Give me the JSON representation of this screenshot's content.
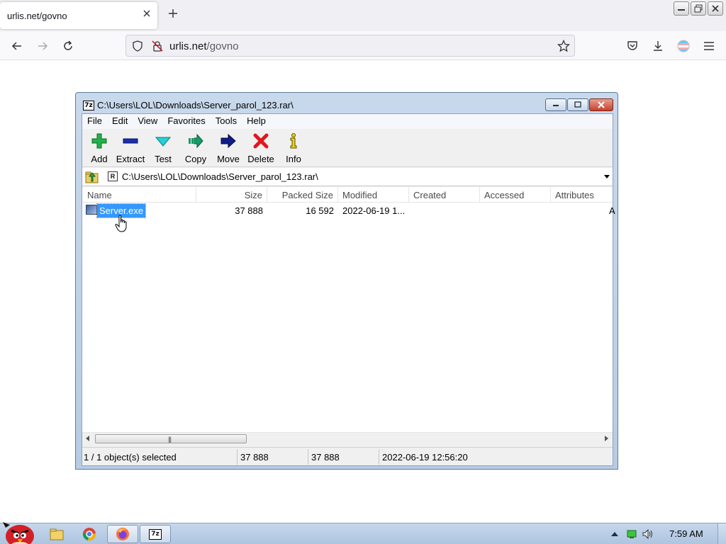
{
  "browser": {
    "tab_title": "urlis.net/govno",
    "url_host": "urlis.net",
    "url_path": "/govno"
  },
  "window": {
    "title": "C:\\Users\\LOL\\Downloads\\Server_parol_123.rar\\",
    "menu": [
      "File",
      "Edit",
      "View",
      "Favorites",
      "Tools",
      "Help"
    ],
    "toolbar": {
      "add": "Add",
      "extract": "Extract",
      "test": "Test",
      "copy": "Copy",
      "move": "Move",
      "delete": "Delete",
      "info": "Info"
    },
    "address": "C:\\Users\\LOL\\Downloads\\Server_parol_123.rar\\",
    "columns": [
      "Name",
      "Size",
      "Packed Size",
      "Modified",
      "Created",
      "Accessed",
      "Attributes"
    ],
    "rows": [
      {
        "name": "Server.exe",
        "size": "37 888",
        "packed": "16 592",
        "modified": "2022-06-19 1...",
        "created": "",
        "accessed": "",
        "attributes": "A"
      }
    ],
    "status": {
      "selection": "1 / 1 object(s) selected",
      "size": "37 888",
      "packed": "37 888",
      "modified": "2022-06-19 12:56:20"
    }
  },
  "taskbar": {
    "clock": "7:59 AM"
  },
  "icons": {
    "tab_close": "close-icon",
    "new_tab": "plus-icon",
    "back": "arrow-left-icon",
    "forward": "arrow-right-icon",
    "reload": "reload-icon",
    "shield": "shield-icon",
    "lock": "lock-icon",
    "bookmark": "star-icon",
    "pocket": "pocket-icon",
    "downloads": "download-icon",
    "account": "account-icon",
    "menu": "hamburger-menu-icon"
  },
  "colors": {
    "selection": "#3399ff",
    "titlebar": "#c9d9ec",
    "add_green": "#22b14c",
    "delete_red": "#e0161e"
  }
}
